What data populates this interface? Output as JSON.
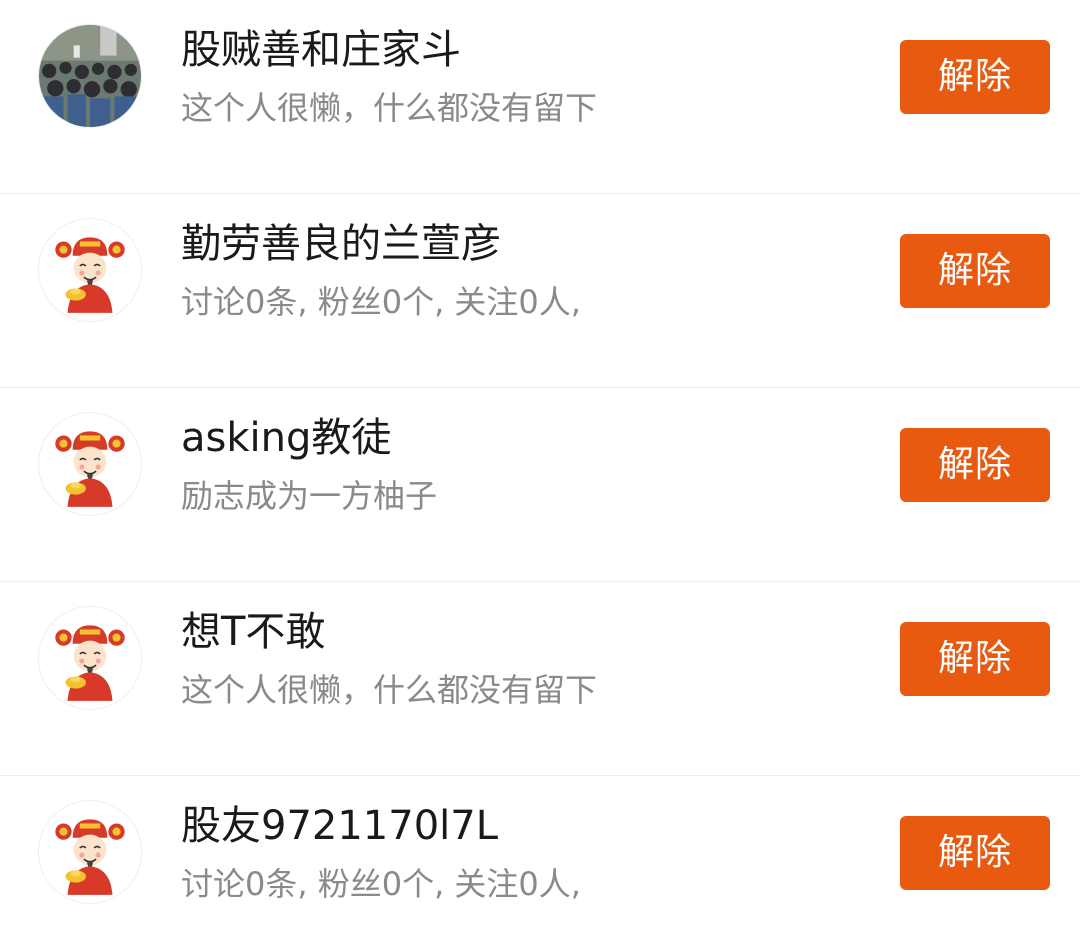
{
  "blocked_users": [
    {
      "name": "股贼善和庄家斗",
      "description": "这个人很懒，什么都没有留下",
      "avatar_icon": "crowd-photo-avatar",
      "action_label": "解除"
    },
    {
      "name": "勤劳善良的兰萱彦",
      "description": "讨论0条, 粉丝0个, 关注0人,",
      "avatar_icon": "god-of-wealth-avatar",
      "action_label": "解除"
    },
    {
      "name": "asking教徒",
      "description": "励志成为一方柚子",
      "avatar_icon": "god-of-wealth-avatar",
      "action_label": "解除"
    },
    {
      "name": "想T不敢",
      "description": "这个人很懒，什么都没有留下",
      "avatar_icon": "god-of-wealth-avatar",
      "action_label": "解除"
    },
    {
      "name": "股友9721170l7L",
      "description": "讨论0条, 粉丝0个, 关注0人,",
      "avatar_icon": "god-of-wealth-avatar",
      "action_label": "解除"
    }
  ],
  "colors": {
    "action_button": "#e85a10",
    "name_text": "#1a1a1a",
    "description_text": "#8a8a8a"
  }
}
